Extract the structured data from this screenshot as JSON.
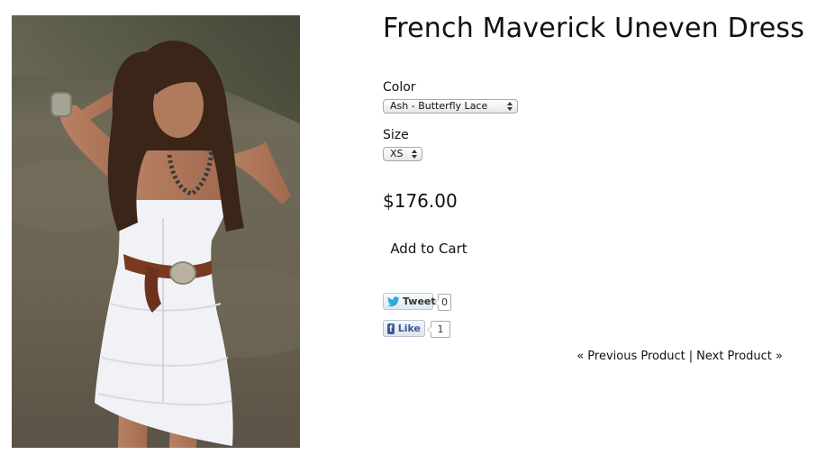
{
  "product": {
    "title": "French Maverick Uneven Dress",
    "image_alt": "Model wearing white uneven hem lace dress with braided brown belt on a beach",
    "price": "$176.00"
  },
  "options": {
    "color_label": "Color",
    "color_selected": "Ash - Butterfly Lace",
    "size_label": "Size",
    "size_selected": "XS"
  },
  "cart": {
    "add_label": "Add to Cart"
  },
  "social": {
    "tweet_label": "Tweet",
    "tweet_count": "0",
    "like_label": "Like",
    "like_count": "1"
  },
  "pagination": {
    "previous_label": "« Previous Product",
    "separator": "|",
    "next_label": "Next Product »"
  },
  "icons": {
    "tweet": "twitter-bird-icon",
    "like": "facebook-f-icon",
    "select_arrows": "updown-arrows-icon"
  },
  "colors": {
    "photo_sand": "#6b6350",
    "dress": "#f2f3f6",
    "belt": "#7a3a22",
    "facebook_blue": "#3b5998",
    "twitter_blue": "#2aa9e0"
  }
}
